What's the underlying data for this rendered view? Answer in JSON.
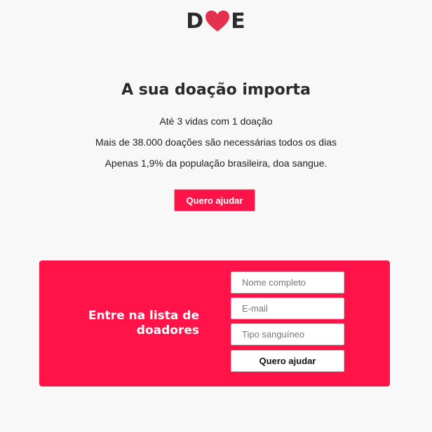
{
  "header": {
    "logo_left": "D",
    "logo_right": "E",
    "logo_icon": "heart-icon"
  },
  "hero": {
    "title": "A sua doação importa",
    "facts": [
      "Até 3 vidas com 1 doação",
      "Mais de 38.000 doações são necessárias todos os dias",
      "Apenas 1,9% da população brasileira, doa sangue."
    ],
    "cta_label": "Quero ajudar"
  },
  "signup": {
    "title": "Entre na lista de doadores",
    "name_placeholder": "Nome completo",
    "email_placeholder": "E-mail",
    "blood_type_placeholder": "Tipo sanguíneo",
    "submit_label": "Quero ajudar"
  },
  "colors": {
    "accent": "#ff1349",
    "heart": "#e6314e",
    "background": "#f8f8f8",
    "text": "#2a2a2a"
  }
}
